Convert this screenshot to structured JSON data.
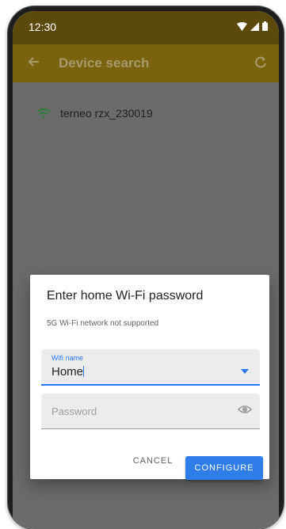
{
  "status_bar": {
    "time": "12:30",
    "icons": [
      "wifi-icon",
      "cellular-signal-icon",
      "battery-icon"
    ]
  },
  "app_bar": {
    "title": "Device search",
    "back_icon": "arrow-back-icon",
    "refresh_icon": "refresh-icon"
  },
  "devices": [
    {
      "name": "terneo rzx_230019",
      "icon": "wifi-signal-icon"
    }
  ],
  "dialog": {
    "title": "Enter home Wi-Fi password",
    "subtitle": "5G Wi-Fi network not supported",
    "ssid_field": {
      "label": "Wifi name",
      "value": "Home",
      "icon": "dropdown-arrow-icon"
    },
    "password_field": {
      "placeholder": "Password",
      "value": "",
      "icon": "eye-icon"
    },
    "cancel_label": "CANCEL",
    "configure_label": "CONFIGURE"
  },
  "colors": {
    "accent": "#2979ff",
    "button": "#2f7de8",
    "app_bar": "#7a620e",
    "status_bar": "#5c4a0c",
    "wifi_green": "#2e7d32"
  }
}
